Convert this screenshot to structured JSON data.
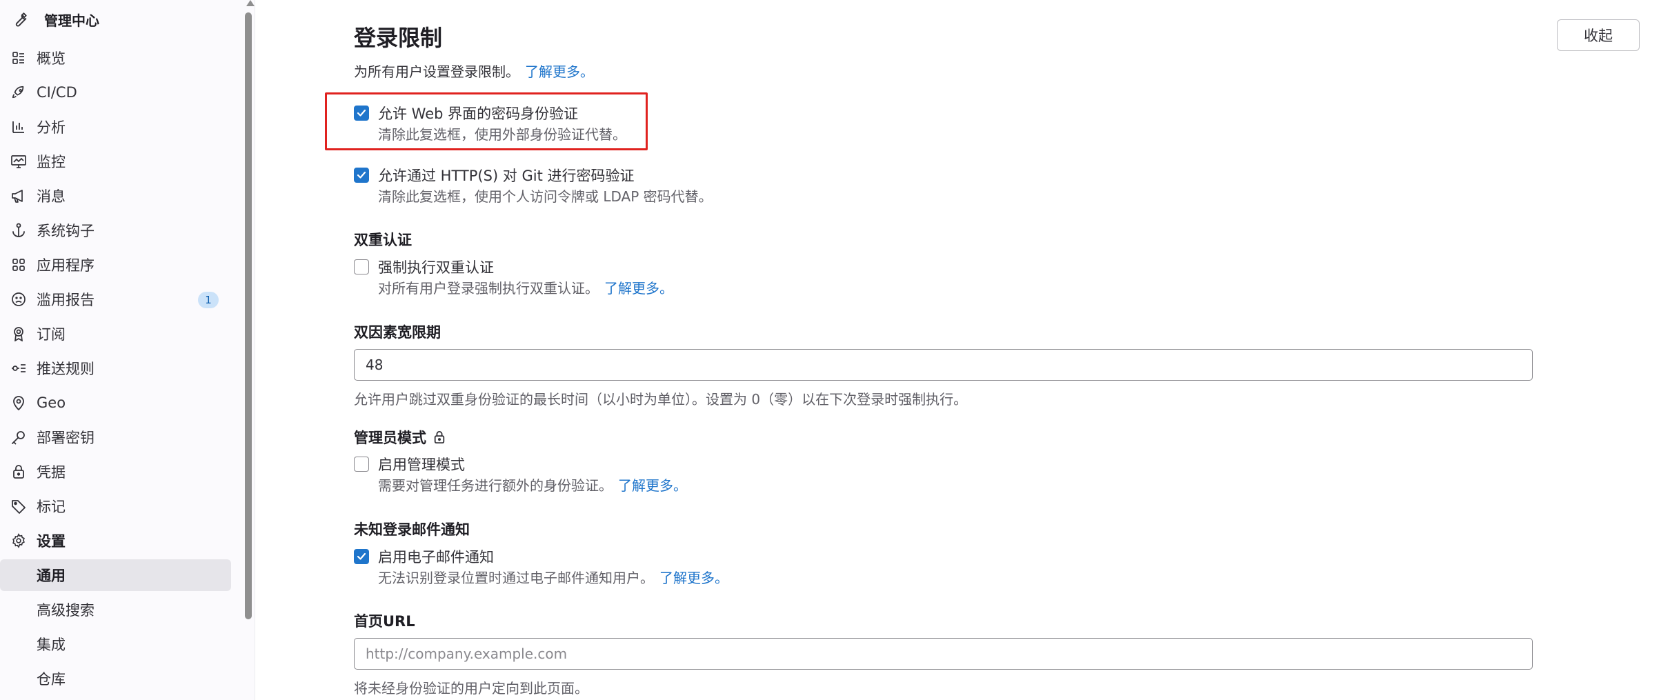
{
  "sidebar": {
    "header": {
      "title": "管理中心",
      "icon": "wrench-icon"
    },
    "items": [
      {
        "label": "概览",
        "icon": "overview-icon"
      },
      {
        "label": "CI/CD",
        "icon": "rocket-icon"
      },
      {
        "label": "分析",
        "icon": "chart-icon"
      },
      {
        "label": "监控",
        "icon": "monitor-icon"
      },
      {
        "label": "消息",
        "icon": "megaphone-icon"
      },
      {
        "label": "系统钩子",
        "icon": "anchor-icon"
      },
      {
        "label": "应用程序",
        "icon": "apps-icon"
      },
      {
        "label": "滥用报告",
        "icon": "sad-face-icon",
        "badge": "1"
      },
      {
        "label": "订阅",
        "icon": "license-icon"
      },
      {
        "label": "推送规则",
        "icon": "push-rules-icon"
      },
      {
        "label": "Geo",
        "icon": "location-icon"
      },
      {
        "label": "部署密钥",
        "icon": "key-icon"
      },
      {
        "label": "凭据",
        "icon": "lock-icon"
      },
      {
        "label": "标记",
        "icon": "tag-icon"
      },
      {
        "label": "设置",
        "icon": "gear-icon"
      },
      {
        "label": "通用"
      },
      {
        "label": "高级搜索"
      },
      {
        "label": "集成"
      },
      {
        "label": "仓库"
      }
    ]
  },
  "main": {
    "collapse_label": "收起",
    "title": "登录限制",
    "subtitle": "为所有用户设置登录限制。",
    "subtitle_link": "了解更多。",
    "web_password": {
      "label": "允许 Web 界面的密码身份验证",
      "help": "清除此复选框，使用外部身份验证代替。",
      "checked": true
    },
    "git_password": {
      "label": "允许通过 HTTP(S) 对 Git 进行密码验证",
      "help": "清除此复选框，使用个人访问令牌或 LDAP 密码代替。",
      "checked": true
    },
    "two_factor": {
      "title": "双重认证",
      "label": "强制执行双重认证",
      "help": "对所有用户登录强制执行双重认证。",
      "link": "了解更多。",
      "checked": false
    },
    "grace_period": {
      "title": "双因素宽限期",
      "value": "48",
      "help": "允许用户跳过双重身份验证的最长时间（以小时为单位）。设置为 0（零）以在下次登录时强制执行。"
    },
    "admin_mode": {
      "title": "管理员模式",
      "label": "启用管理模式",
      "help": "需要对管理任务进行额外的身份验证。",
      "link": "了解更多。",
      "checked": false
    },
    "email_notify": {
      "title": "未知登录邮件通知",
      "label": "启用电子邮件通知",
      "help": "无法识别登录位置时通过电子邮件通知用户。",
      "link": "了解更多。",
      "checked": true
    },
    "home_url": {
      "title": "首页URL",
      "placeholder": "http://company.example.com",
      "value": "",
      "help": "将未经身份验证的用户定向到此页面。"
    }
  },
  "colors": {
    "accent": "#1f75cb",
    "highlight": "#e0221f",
    "badge_bg": "#cbe2f9"
  }
}
